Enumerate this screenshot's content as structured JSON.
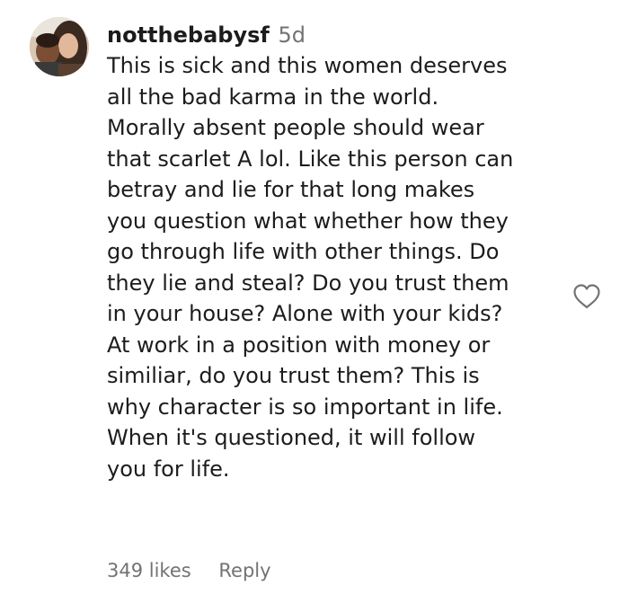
{
  "comment": {
    "username": "notthebabysf",
    "timestamp": "5d",
    "lines": [
      "This is sick and this women deserves",
      "all the bad karma in the world.",
      "Morally absent people should wear",
      "that scarlet A lol. Like this person can",
      "betray and lie for that long makes",
      "you question what whether how they",
      "go through life with other things. Do",
      "they lie and steal? Do you trust them",
      "in your house? Alone with your kids?",
      "At work in a position with money or",
      "similiar, do you trust them? This is",
      "why character is so important in life.",
      "When it's questioned, it will follow",
      "you for life."
    ],
    "likes": "349 likes",
    "reply_label": "Reply",
    "like_icon": "heart-outline-icon"
  }
}
